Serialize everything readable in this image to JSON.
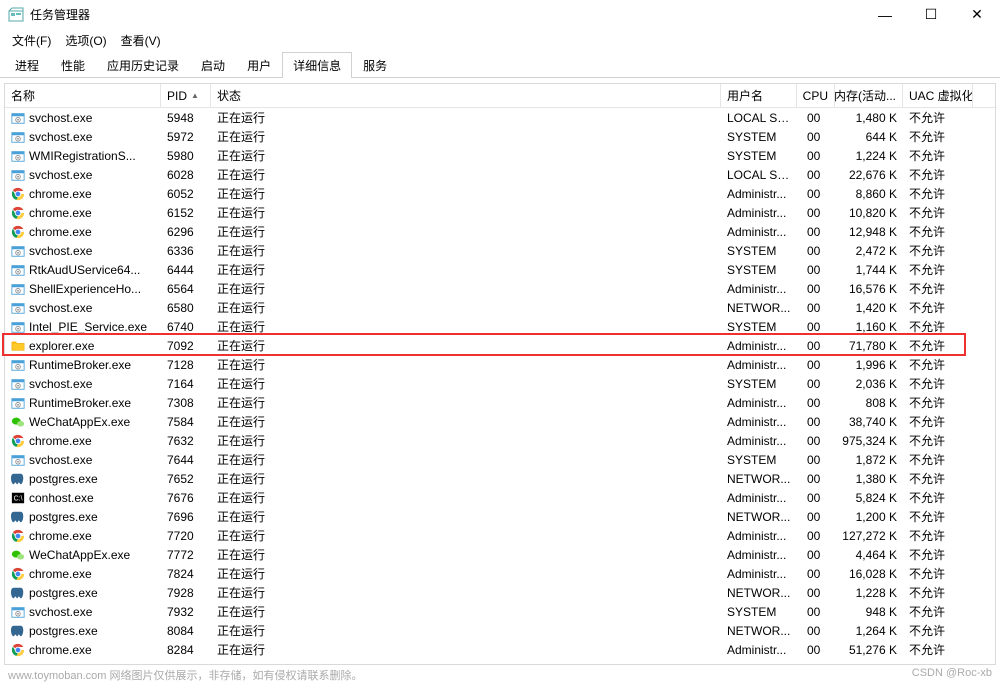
{
  "window": {
    "title": "任务管理器",
    "controls": {
      "min": "—",
      "max": "☐",
      "close": "✕"
    }
  },
  "menu": {
    "file": "文件(F)",
    "options": "选项(O)",
    "view": "查看(V)"
  },
  "tabs": {
    "processes": "进程",
    "performance": "性能",
    "app_history": "应用历史记录",
    "startup": "启动",
    "users": "用户",
    "details": "详细信息",
    "services": "服务"
  },
  "columns": {
    "name": "名称",
    "pid": "PID",
    "status": "状态",
    "user": "用户名",
    "cpu": "CPU",
    "memory": "内存(活动...",
    "uac": "UAC 虚拟化"
  },
  "status_running": "正在运行",
  "uac_disallow": "不允许",
  "rows": [
    {
      "icon": "svc",
      "name": "svchost.exe",
      "pid": "5948",
      "user": "LOCAL SE...",
      "cpu": "00",
      "mem": "1,480 K"
    },
    {
      "icon": "svc",
      "name": "svchost.exe",
      "pid": "5972",
      "user": "SYSTEM",
      "cpu": "00",
      "mem": "644 K"
    },
    {
      "icon": "svc",
      "name": "WMIRegistrationS...",
      "pid": "5980",
      "user": "SYSTEM",
      "cpu": "00",
      "mem": "1,224 K"
    },
    {
      "icon": "svc",
      "name": "svchost.exe",
      "pid": "6028",
      "user": "LOCAL SE...",
      "cpu": "00",
      "mem": "22,676 K"
    },
    {
      "icon": "chrome",
      "name": "chrome.exe",
      "pid": "6052",
      "user": "Administr...",
      "cpu": "00",
      "mem": "8,860 K"
    },
    {
      "icon": "chrome",
      "name": "chrome.exe",
      "pid": "6152",
      "user": "Administr...",
      "cpu": "00",
      "mem": "10,820 K"
    },
    {
      "icon": "chrome",
      "name": "chrome.exe",
      "pid": "6296",
      "user": "Administr...",
      "cpu": "00",
      "mem": "12,948 K"
    },
    {
      "icon": "svc",
      "name": "svchost.exe",
      "pid": "6336",
      "user": "SYSTEM",
      "cpu": "00",
      "mem": "2,472 K"
    },
    {
      "icon": "svc",
      "name": "RtkAudUService64...",
      "pid": "6444",
      "user": "SYSTEM",
      "cpu": "00",
      "mem": "1,744 K"
    },
    {
      "icon": "svc",
      "name": "ShellExperienceHo...",
      "pid": "6564",
      "user": "Administr...",
      "cpu": "00",
      "mem": "16,576 K"
    },
    {
      "icon": "svc",
      "name": "svchost.exe",
      "pid": "6580",
      "user": "NETWOR...",
      "cpu": "00",
      "mem": "1,420 K"
    },
    {
      "icon": "svc",
      "name": "Intel_PIE_Service.exe",
      "pid": "6740",
      "user": "SYSTEM",
      "cpu": "00",
      "mem": "1,160 K"
    },
    {
      "icon": "explorer",
      "name": "explorer.exe",
      "pid": "7092",
      "user": "Administr...",
      "cpu": "00",
      "mem": "71,780 K",
      "highlight": true
    },
    {
      "icon": "svc",
      "name": "RuntimeBroker.exe",
      "pid": "7128",
      "user": "Administr...",
      "cpu": "00",
      "mem": "1,996 K"
    },
    {
      "icon": "svc",
      "name": "svchost.exe",
      "pid": "7164",
      "user": "SYSTEM",
      "cpu": "00",
      "mem": "2,036 K"
    },
    {
      "icon": "svc",
      "name": "RuntimeBroker.exe",
      "pid": "7308",
      "user": "Administr...",
      "cpu": "00",
      "mem": "808 K"
    },
    {
      "icon": "wechat",
      "name": "WeChatAppEx.exe",
      "pid": "7584",
      "user": "Administr...",
      "cpu": "00",
      "mem": "38,740 K"
    },
    {
      "icon": "chrome",
      "name": "chrome.exe",
      "pid": "7632",
      "user": "Administr...",
      "cpu": "00",
      "mem": "975,324 K"
    },
    {
      "icon": "svc",
      "name": "svchost.exe",
      "pid": "7644",
      "user": "SYSTEM",
      "cpu": "00",
      "mem": "1,872 K"
    },
    {
      "icon": "pg",
      "name": "postgres.exe",
      "pid": "7652",
      "user": "NETWOR...",
      "cpu": "00",
      "mem": "1,380 K"
    },
    {
      "icon": "conhost",
      "name": "conhost.exe",
      "pid": "7676",
      "user": "Administr...",
      "cpu": "00",
      "mem": "5,824 K"
    },
    {
      "icon": "pg",
      "name": "postgres.exe",
      "pid": "7696",
      "user": "NETWOR...",
      "cpu": "00",
      "mem": "1,200 K"
    },
    {
      "icon": "chrome",
      "name": "chrome.exe",
      "pid": "7720",
      "user": "Administr...",
      "cpu": "00",
      "mem": "127,272 K"
    },
    {
      "icon": "wechat",
      "name": "WeChatAppEx.exe",
      "pid": "7772",
      "user": "Administr...",
      "cpu": "00",
      "mem": "4,464 K"
    },
    {
      "icon": "chrome",
      "name": "chrome.exe",
      "pid": "7824",
      "user": "Administr...",
      "cpu": "00",
      "mem": "16,028 K"
    },
    {
      "icon": "pg",
      "name": "postgres.exe",
      "pid": "7928",
      "user": "NETWOR...",
      "cpu": "00",
      "mem": "1,228 K"
    },
    {
      "icon": "svc",
      "name": "svchost.exe",
      "pid": "7932",
      "user": "SYSTEM",
      "cpu": "00",
      "mem": "948 K"
    },
    {
      "icon": "pg",
      "name": "postgres.exe",
      "pid": "8084",
      "user": "NETWOR...",
      "cpu": "00",
      "mem": "1,264 K"
    },
    {
      "icon": "chrome",
      "name": "chrome.exe",
      "pid": "8284",
      "user": "Administr...",
      "cpu": "00",
      "mem": "51,276 K"
    }
  ],
  "footer": {
    "left": "www.toymoban.com   网络图片仅供展示，非存储，如有侵权请联系删除。",
    "right": "CSDN @Roc-xb"
  }
}
